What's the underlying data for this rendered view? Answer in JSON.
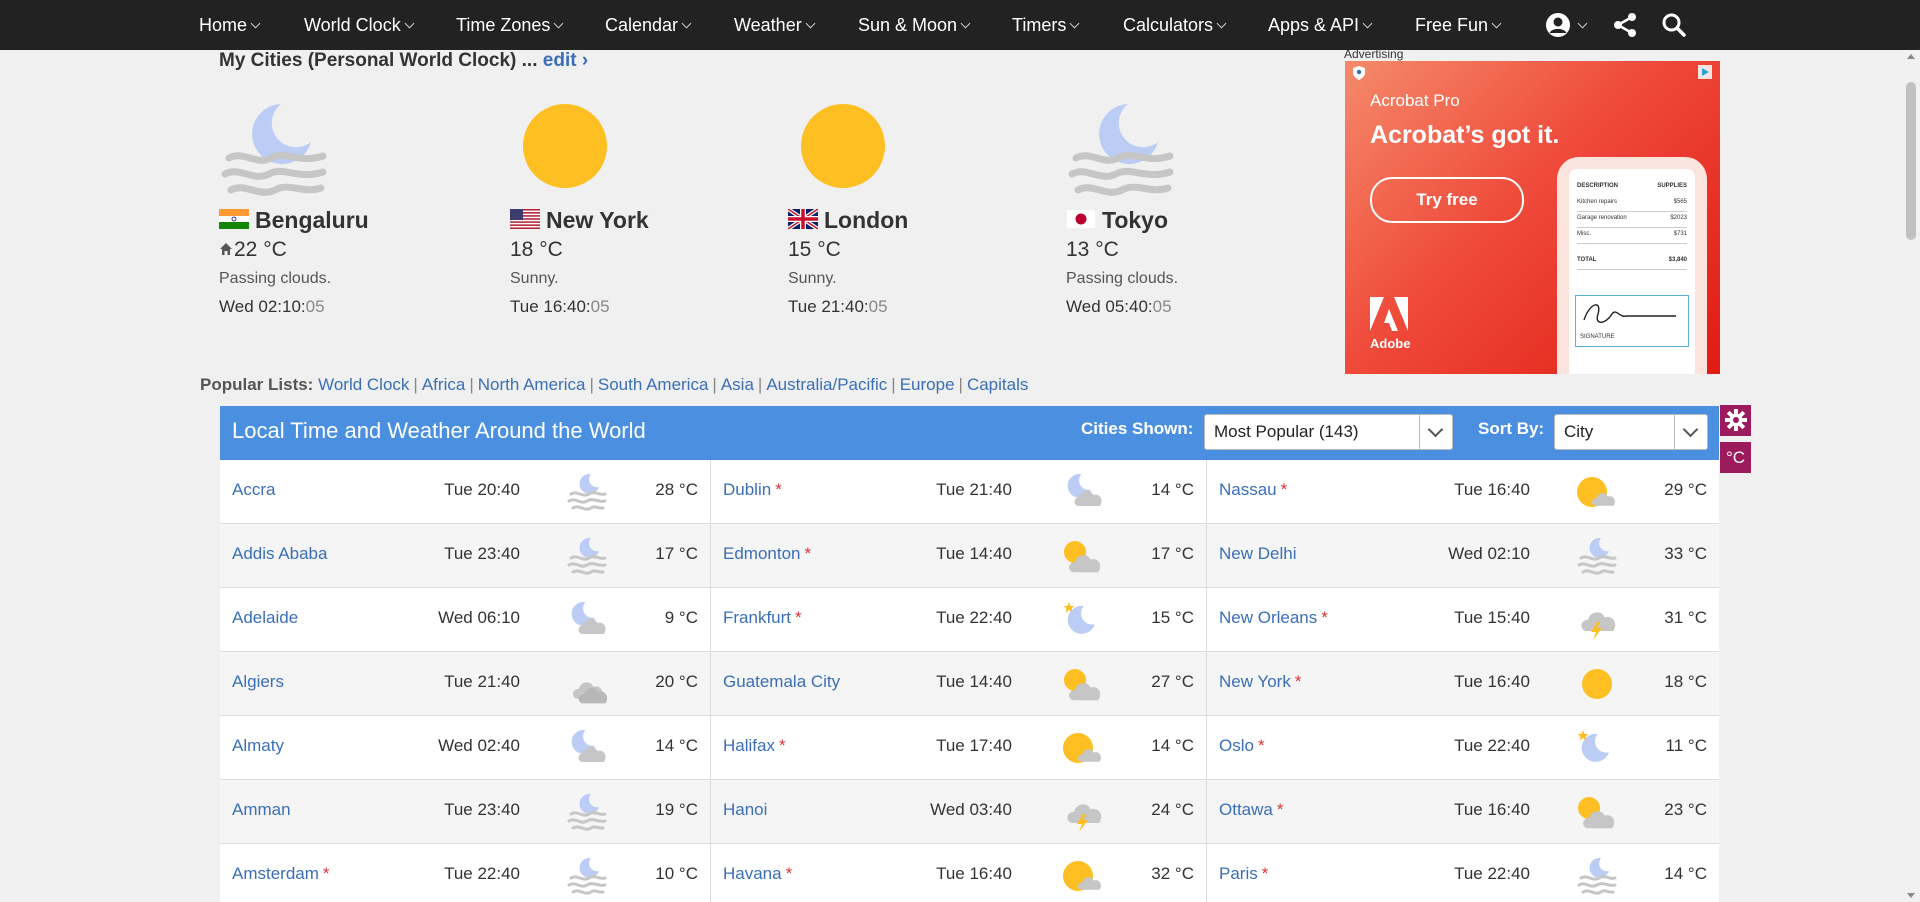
{
  "nav": {
    "items": [
      "Home",
      "World Clock",
      "Time Zones",
      "Calendar",
      "Weather",
      "Sun & Moon",
      "Timers",
      "Calculators",
      "Apps & API",
      "Free Fun"
    ],
    "icons": [
      "user-icon",
      "share-icon",
      "search-icon"
    ]
  },
  "my_cities": {
    "title": "My Cities (Personal World Clock) ...",
    "edit_label": "edit ›",
    "cities": [
      {
        "name": "Bengaluru",
        "flag": "india",
        "home": true,
        "temp": "22 °C",
        "condition": "Passing clouds.",
        "time": "Wed 02:10:",
        "seconds": "05",
        "icon": "night-cloud-icon"
      },
      {
        "name": "New York",
        "flag": "usa",
        "home": false,
        "temp": "18 °C",
        "condition": "Sunny.",
        "time": "Tue 16:40:",
        "seconds": "05",
        "icon": "sun-icon"
      },
      {
        "name": "London",
        "flag": "uk",
        "home": false,
        "temp": "15 °C",
        "condition": "Sunny.",
        "time": "Tue 21:40:",
        "seconds": "05",
        "icon": "sun-icon"
      },
      {
        "name": "Tokyo",
        "flag": "japan",
        "home": false,
        "temp": "13 °C",
        "condition": "Passing clouds.",
        "time": "Wed 05:40:",
        "seconds": "05",
        "icon": "night-cloud-icon"
      }
    ]
  },
  "ad": {
    "label": "Advertising",
    "brand": "Acrobat Pro",
    "headline": "Acrobat’s got it.",
    "cta": "Try free",
    "logo_text": "Adobe",
    "doc_heading_left": "DESCRIPTION",
    "doc_heading_right": "SUPPLIES",
    "doc_lines": [
      {
        "l": "Kitchen repairs",
        "r": "$565"
      },
      {
        "l": "Garage renovation",
        "r": "$2023"
      },
      {
        "l": "Misc.",
        "r": "$731"
      },
      {
        "l": "TOTAL",
        "r": "$3,840"
      }
    ],
    "signature_label": "SIGNATURE"
  },
  "popular": {
    "label": "Popular Lists:",
    "links": [
      "World Clock",
      "Africa",
      "North America",
      "South America",
      "Asia",
      "Australia/Pacific",
      "Europe",
      "Capitals"
    ]
  },
  "table": {
    "title": "Local Time and Weather Around the World",
    "cities_shown_label": "Cities Shown:",
    "cities_shown_value": "Most Popular (143)",
    "sort_by_label": "Sort By:",
    "sort_by_value": "City",
    "unit_button": "°C",
    "columns": [
      [
        {
          "city": "Accra",
          "dst": false,
          "time": "Tue 20:40",
          "icon": "night-fog-icon",
          "temp": "28 °C"
        },
        {
          "city": "Addis Ababa",
          "dst": false,
          "time": "Tue 23:40",
          "icon": "night-fog-icon",
          "temp": "17 °C"
        },
        {
          "city": "Adelaide",
          "dst": false,
          "time": "Wed 06:10",
          "icon": "night-cloud-icon",
          "temp": "9 °C"
        },
        {
          "city": "Algiers",
          "dst": false,
          "time": "Tue 21:40",
          "icon": "cloud-icon",
          "temp": "20 °C"
        },
        {
          "city": "Almaty",
          "dst": false,
          "time": "Wed 02:40",
          "icon": "night-cloud-icon",
          "temp": "14 °C"
        },
        {
          "city": "Amman",
          "dst": false,
          "time": "Tue 23:40",
          "icon": "night-fog-icon",
          "temp": "19 °C"
        },
        {
          "city": "Amsterdam",
          "dst": true,
          "time": "Tue 22:40",
          "icon": "night-fog-icon",
          "temp": "10 °C"
        }
      ],
      [
        {
          "city": "Dublin",
          "dst": true,
          "time": "Tue 21:40",
          "icon": "night-cloud-icon",
          "temp": "14 °C"
        },
        {
          "city": "Edmonton",
          "dst": true,
          "time": "Tue 14:40",
          "icon": "sun-cloud-icon",
          "temp": "17 °C"
        },
        {
          "city": "Frankfurt",
          "dst": true,
          "time": "Tue 22:40",
          "icon": "moon-star-icon",
          "temp": "15 °C"
        },
        {
          "city": "Guatemala City",
          "dst": false,
          "time": "Tue 14:40",
          "icon": "sun-cloud-icon",
          "temp": "27 °C"
        },
        {
          "city": "Halifax",
          "dst": true,
          "time": "Tue 17:40",
          "icon": "sun-small-cloud-icon",
          "temp": "14 °C"
        },
        {
          "city": "Hanoi",
          "dst": false,
          "time": "Wed 03:40",
          "icon": "thunderstorm-icon",
          "temp": "24 °C"
        },
        {
          "city": "Havana",
          "dst": true,
          "time": "Tue 16:40",
          "icon": "sun-small-cloud-icon",
          "temp": "32 °C"
        }
      ],
      [
        {
          "city": "Nassau",
          "dst": true,
          "time": "Tue 16:40",
          "icon": "sun-small-cloud-icon",
          "temp": "29 °C"
        },
        {
          "city": "New Delhi",
          "dst": false,
          "time": "Wed 02:10",
          "icon": "night-fog-icon",
          "temp": "33 °C"
        },
        {
          "city": "New Orleans",
          "dst": true,
          "time": "Tue 15:40",
          "icon": "thunderstorm-icon",
          "temp": "31 °C"
        },
        {
          "city": "New York",
          "dst": true,
          "time": "Tue 16:40",
          "icon": "sun-icon",
          "temp": "18 °C"
        },
        {
          "city": "Oslo",
          "dst": true,
          "time": "Tue 22:40",
          "icon": "moon-star-icon",
          "temp": "11 °C"
        },
        {
          "city": "Ottawa",
          "dst": true,
          "time": "Tue 16:40",
          "icon": "sun-cloud-icon",
          "temp": "23 °C"
        },
        {
          "city": "Paris",
          "dst": true,
          "time": "Tue 22:40",
          "icon": "night-fog-icon",
          "temp": "14 °C"
        }
      ]
    ]
  },
  "colors": {
    "nav_bg": "#222222",
    "link": "#3a6fb8",
    "table_header": "#4a8fe0",
    "side_button": "#9c1b5c",
    "sun": "#fdbf21",
    "moon": "#bccdf5",
    "cloud": "#c6c6c6",
    "dst_marker": "#dd3333"
  }
}
